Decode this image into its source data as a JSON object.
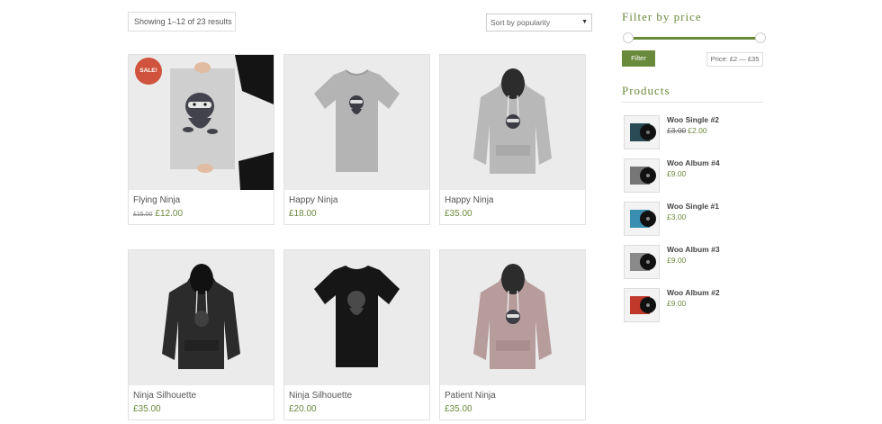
{
  "toolbar": {
    "results_text": "Showing 1–12 of 23 results",
    "sort_selected": "Sort by popularity"
  },
  "products": [
    {
      "name": "Flying Ninja",
      "old_price": "£15.00",
      "price": "£12.00",
      "badge": "SALE!",
      "image": "poster-ninja"
    },
    {
      "name": "Happy Ninja",
      "price": "£18.00",
      "image": "grey-tshirt"
    },
    {
      "name": "Happy Ninja",
      "price": "£35.00",
      "image": "grey-hoodie"
    },
    {
      "name": "Ninja Silhouette",
      "price": "£35.00",
      "image": "black-hoodie"
    },
    {
      "name": "Ninja Silhouette",
      "price": "£20.00",
      "image": "black-tshirt"
    },
    {
      "name": "Patient Ninja",
      "price": "£35.00",
      "image": "pink-hoodie"
    }
  ],
  "sidebar": {
    "filter_title": "Filter by price",
    "filter_button": "Filter",
    "price_range": "Price: £2 — £35",
    "products_title": "Products",
    "product_list": [
      {
        "name": "Woo Single #2",
        "old_price": "£3.00",
        "price": "£2.00",
        "color": "#2a4a55"
      },
      {
        "name": "Woo Album #4",
        "price": "£9.00",
        "color": "#777777"
      },
      {
        "name": "Woo Single #1",
        "price": "£3.00",
        "color": "#3a8fb0"
      },
      {
        "name": "Woo Album #3",
        "price": "£9.00",
        "color": "#8a8a8a"
      },
      {
        "name": "Woo Album #2",
        "price": "£9.00",
        "color": "#c0392b"
      }
    ]
  },
  "colors": {
    "accent": "#6a8a3b",
    "sale": "#d0533d"
  }
}
